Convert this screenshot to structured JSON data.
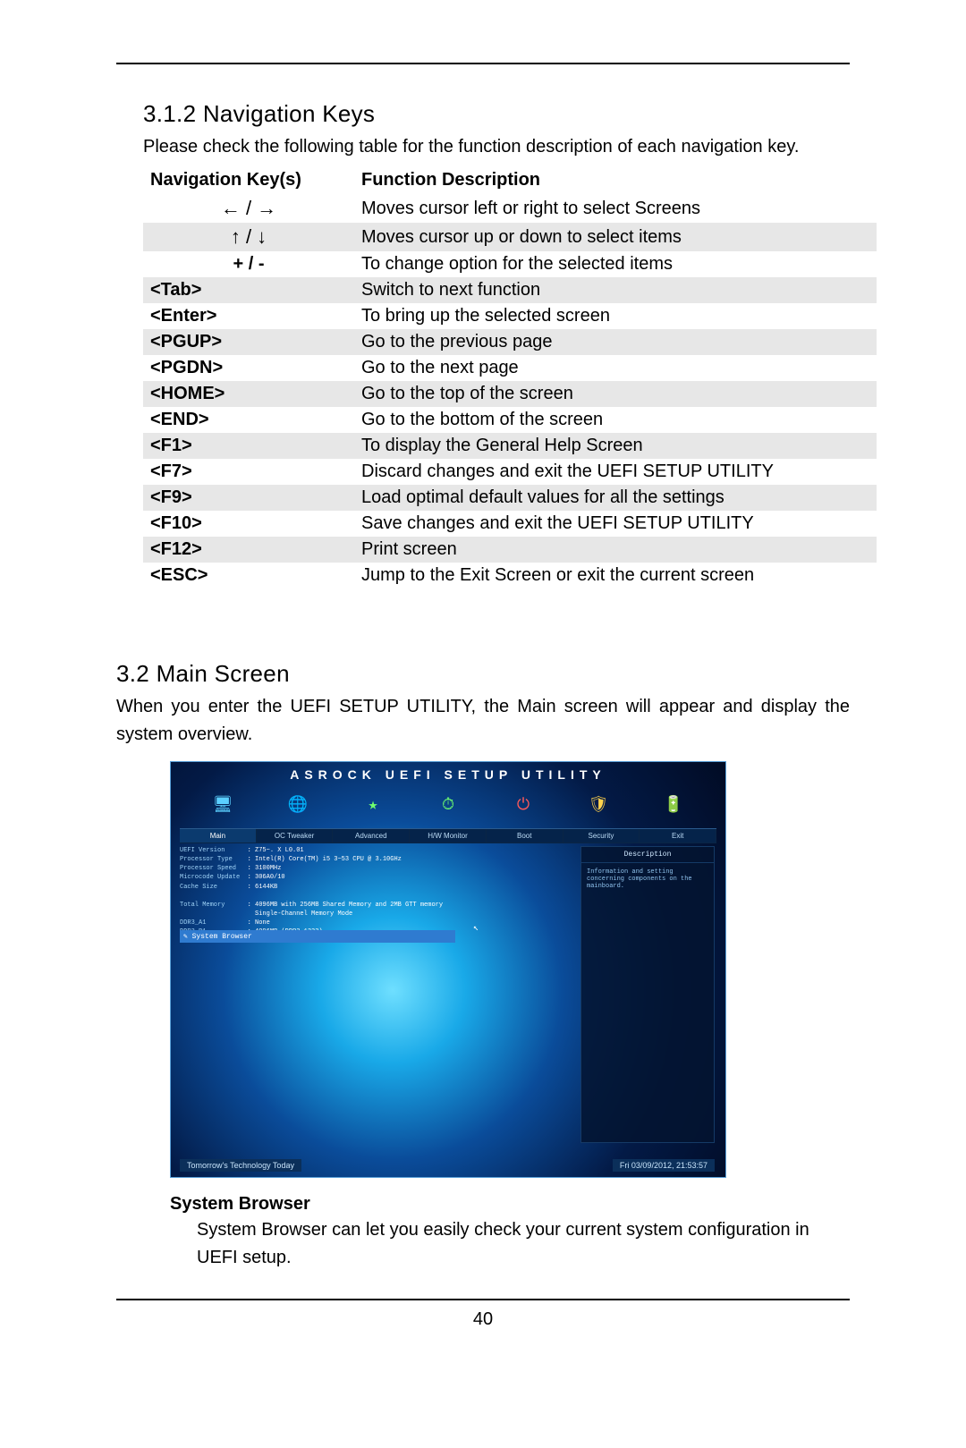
{
  "section312": {
    "heading": "3.1.2  Navigation Keys",
    "intro": "Please check the following table for the function description of each navigation key."
  },
  "nav_table": {
    "header_keys": "Navigation Key(s)",
    "header_desc": "Function Description",
    "rows": [
      {
        "key": "←  /  →",
        "arrow": true,
        "desc": "Moves cursor left or right to select Screens",
        "shade": false
      },
      {
        "key": "↑  /  ↓",
        "arrow": true,
        "desc": "Moves cursor up or down to select items",
        "shade": true
      },
      {
        "key": "+  /  -",
        "center": true,
        "desc": "To change option for the selected items",
        "shade": false
      },
      {
        "key": "<Tab>",
        "desc": "Switch to next function",
        "shade": true
      },
      {
        "key": "<Enter>",
        "desc": "To bring up the selected screen",
        "shade": false
      },
      {
        "key": "<PGUP>",
        "desc": "Go to the previous page",
        "shade": true
      },
      {
        "key": "<PGDN>",
        "desc": "Go to the next page",
        "shade": false
      },
      {
        "key": "<HOME>",
        "desc": "Go to the top of the screen",
        "shade": true
      },
      {
        "key": "<END>",
        "desc": "Go to the bottom of the screen",
        "shade": false
      },
      {
        "key": "<F1>",
        "desc": "To display the General Help Screen",
        "shade": true
      },
      {
        "key": "<F7>",
        "desc": "Discard changes and exit the UEFI SETUP UTILITY",
        "shade": false
      },
      {
        "key": "<F9>",
        "desc": "Load optimal default values for all the settings",
        "shade": true
      },
      {
        "key": "<F10>",
        "desc": "Save changes and exit the UEFI SETUP UTILITY",
        "shade": false
      },
      {
        "key": "<F12>",
        "desc": "Print screen",
        "shade": true
      },
      {
        "key": "<ESC>",
        "desc": "Jump to the Exit Screen or exit the current screen",
        "shade": false
      }
    ]
  },
  "section32": {
    "heading": "3.2  Main Screen",
    "intro": "When you enter the UEFI SETUP UTILITY, the Main screen will appear and display the system overview."
  },
  "uefi": {
    "title": "ASROCK UEFI SETUP UTILITY",
    "tabs": [
      "Main",
      "OC Tweaker",
      "Advanced",
      "H/W Monitor",
      "Boot",
      "Security",
      "Exit"
    ],
    "active_tab": 0,
    "side_title": "Description",
    "side_body": "Information and setting concerning components on the mainboard.",
    "info": [
      {
        "label": "UEFI Version",
        "value": ": Z75~. X L0.01"
      },
      {
        "label": "Processor Type",
        "value": ": Intel(R) Core(TM) i5 3~53 CPU @ 3.10GHz"
      },
      {
        "label": "Processor Speed",
        "value": ": 3100MHz"
      },
      {
        "label": "Microcode Update",
        "value": ": 306A0/10"
      },
      {
        "label": "Cache Size",
        "value": ": 6144KB"
      },
      {
        "label": "",
        "value": ""
      },
      {
        "label": "Total Memory",
        "value": ": 4096MB with 256MB Shared Memory and 2MB GTT memory"
      },
      {
        "label": "",
        "value": "  Single-Channel Memory Mode"
      },
      {
        "label": "DDR3_A1",
        "value": ": None"
      },
      {
        "label": "DDR3_B1",
        "value": ": 4096MB (DDR3-1333)"
      }
    ],
    "highlight": "✎ System Browser",
    "footer_left": "Tomorrow's Technology Today",
    "footer_right": "Fri 03/09/2012, 21:53:57"
  },
  "system_browser": {
    "heading": "System Browser",
    "body": "System Browser can let you easily check your current system configuration in UEFI setup."
  },
  "page_number": "40"
}
